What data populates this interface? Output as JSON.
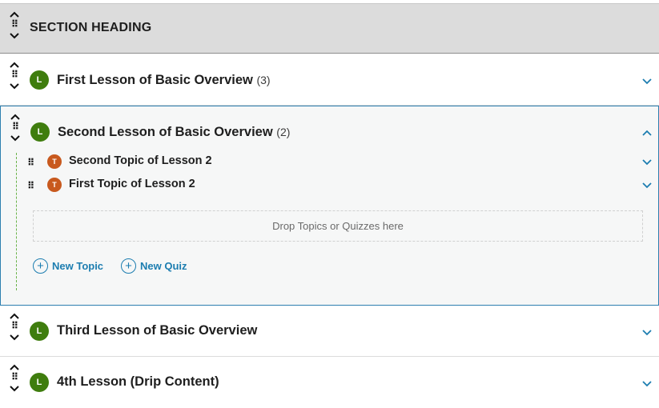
{
  "section": {
    "heading": "SECTION HEADING"
  },
  "lessons": [
    {
      "badge": "L",
      "title": "First Lesson of Basic Overview",
      "count": "(3)"
    },
    {
      "badge": "L",
      "title": "Second Lesson of Basic Overview",
      "count": "(2)",
      "topics": [
        {
          "badge": "T",
          "title": "Second Topic of Lesson 2"
        },
        {
          "badge": "T",
          "title": "First Topic of Lesson 2"
        }
      ],
      "dropzone": "Drop Topics or Quizzes here",
      "new_topic": "New Topic",
      "new_quiz": "New Quiz"
    },
    {
      "badge": "L",
      "title": "Third Lesson of Basic Overview",
      "count": ""
    },
    {
      "badge": "L",
      "title": "4th Lesson (Drip Content)",
      "count": ""
    }
  ],
  "icons": {
    "grip": "⠿",
    "plus": "+"
  },
  "colors": {
    "lesson_badge": "#3f7d0e",
    "topic_badge": "#c8591e",
    "accent": "#1c7db0",
    "expanded_border": "#2d7fb0"
  }
}
